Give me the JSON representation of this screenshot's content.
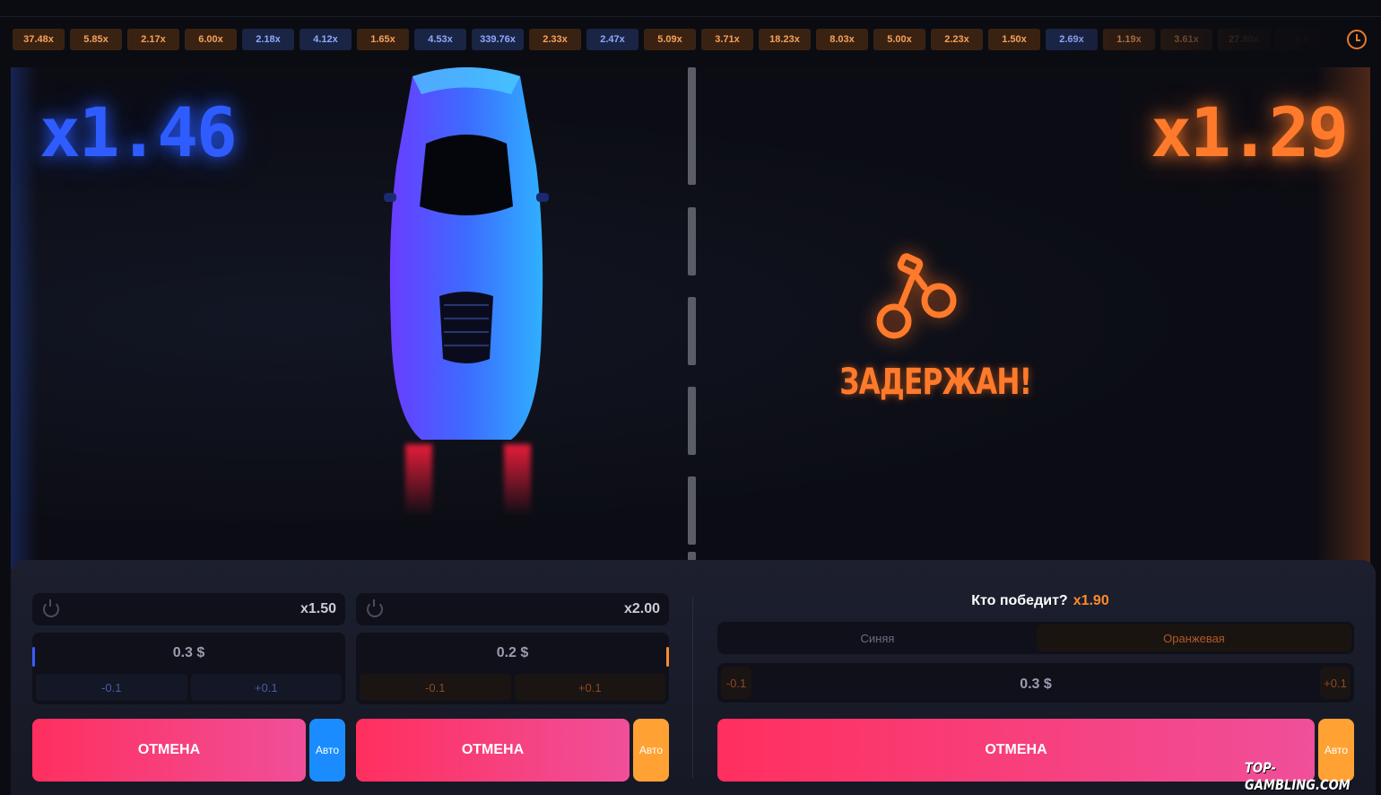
{
  "history": [
    {
      "value": "37.48x",
      "team": "o"
    },
    {
      "value": "5.85x",
      "team": "o"
    },
    {
      "value": "2.17x",
      "team": "o"
    },
    {
      "value": "6.00x",
      "team": "o"
    },
    {
      "value": "2.18x",
      "team": "b"
    },
    {
      "value": "4.12x",
      "team": "b"
    },
    {
      "value": "1.65x",
      "team": "o"
    },
    {
      "value": "4.53x",
      "team": "b"
    },
    {
      "value": "339.76x",
      "team": "b"
    },
    {
      "value": "2.33x",
      "team": "o"
    },
    {
      "value": "2.47x",
      "team": "b"
    },
    {
      "value": "5.09x",
      "team": "o"
    },
    {
      "value": "3.71x",
      "team": "o"
    },
    {
      "value": "18.23x",
      "team": "o"
    },
    {
      "value": "8.03x",
      "team": "o"
    },
    {
      "value": "5.00x",
      "team": "o"
    },
    {
      "value": "2.23x",
      "team": "o"
    },
    {
      "value": "1.50x",
      "team": "o"
    },
    {
      "value": "2.69x",
      "team": "b"
    },
    {
      "value": "1.19x",
      "team": "o"
    },
    {
      "value": "3.61x",
      "team": "o"
    },
    {
      "value": "27.80x",
      "team": "o"
    },
    {
      "value": "3.1",
      "team": "o"
    }
  ],
  "game": {
    "blue_multiplier": "x1.46",
    "orange_multiplier": "x1.29",
    "orange_status": "ЗАДЕРЖАН!"
  },
  "bets": {
    "blue": {
      "auto_cashout": "x1.50",
      "amount": "0.3 $",
      "minus": "-0.1",
      "plus": "+0.1",
      "cancel_label": "ОТМЕНА",
      "auto_label": "Авто"
    },
    "orange": {
      "auto_cashout": "x2.00",
      "amount": "0.2 $",
      "minus": "-0.1",
      "plus": "+0.1",
      "cancel_label": "ОТМЕНА",
      "auto_label": "Авто"
    },
    "winner": {
      "question": "Кто победит?",
      "odds": "x1.90",
      "team_blue": "Синяя",
      "team_orange": "Оранжевая",
      "selected": "Оранжевая",
      "amount": "0.3 $",
      "minus": "-0.1",
      "plus": "+0.1",
      "cancel_label": "ОТМЕНА",
      "auto_label": "Авто"
    }
  },
  "watermark": "TOP-GAMBLING.COM",
  "colors": {
    "blue": "#2f5cff",
    "orange": "#ff7a2a",
    "cancel": "#ff2f5e",
    "auto_blue": "#1a8cff",
    "auto_orange": "#ffa133"
  }
}
